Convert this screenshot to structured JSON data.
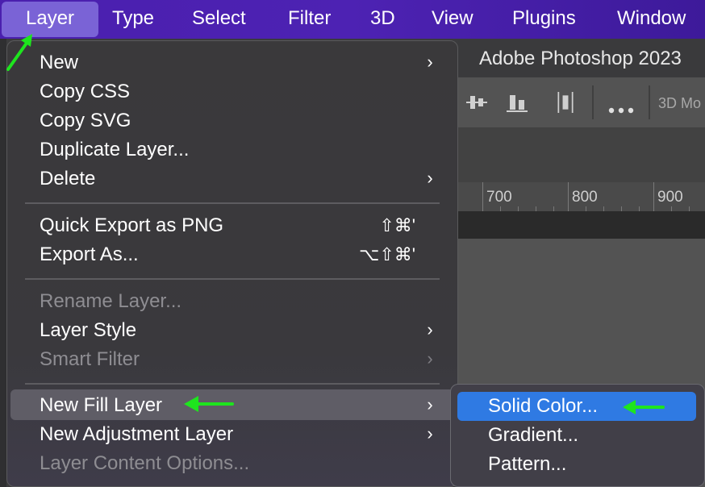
{
  "menubar": {
    "items": [
      "Layer",
      "Type",
      "Select",
      "Filter",
      "3D",
      "View",
      "Plugins",
      "Window"
    ]
  },
  "app": {
    "title": "Adobe Photoshop 2023",
    "mode_label": "3D Mo"
  },
  "ruler": {
    "labels": [
      "700",
      "800",
      "900"
    ]
  },
  "layer_menu": {
    "new": "New",
    "copy_css": "Copy CSS",
    "copy_svg": "Copy SVG",
    "duplicate_layer": "Duplicate Layer...",
    "delete": "Delete",
    "quick_export": "Quick Export as PNG",
    "quick_export_shortcut": "⇧⌘'",
    "export_as": "Export As...",
    "export_as_shortcut": "⌥⇧⌘'",
    "rename_layer": "Rename Layer...",
    "layer_style": "Layer Style",
    "smart_filter": "Smart Filter",
    "new_fill_layer": "New Fill Layer",
    "new_adjustment_layer": "New Adjustment Layer",
    "layer_content_options": "Layer Content Options..."
  },
  "fill_submenu": {
    "items": [
      "Solid Color...",
      "Gradient...",
      "Pattern..."
    ]
  },
  "colors": {
    "menubar": "#4a1fae",
    "selection": "#2f7ae3",
    "annotation_arrow": "#1ee51e"
  }
}
